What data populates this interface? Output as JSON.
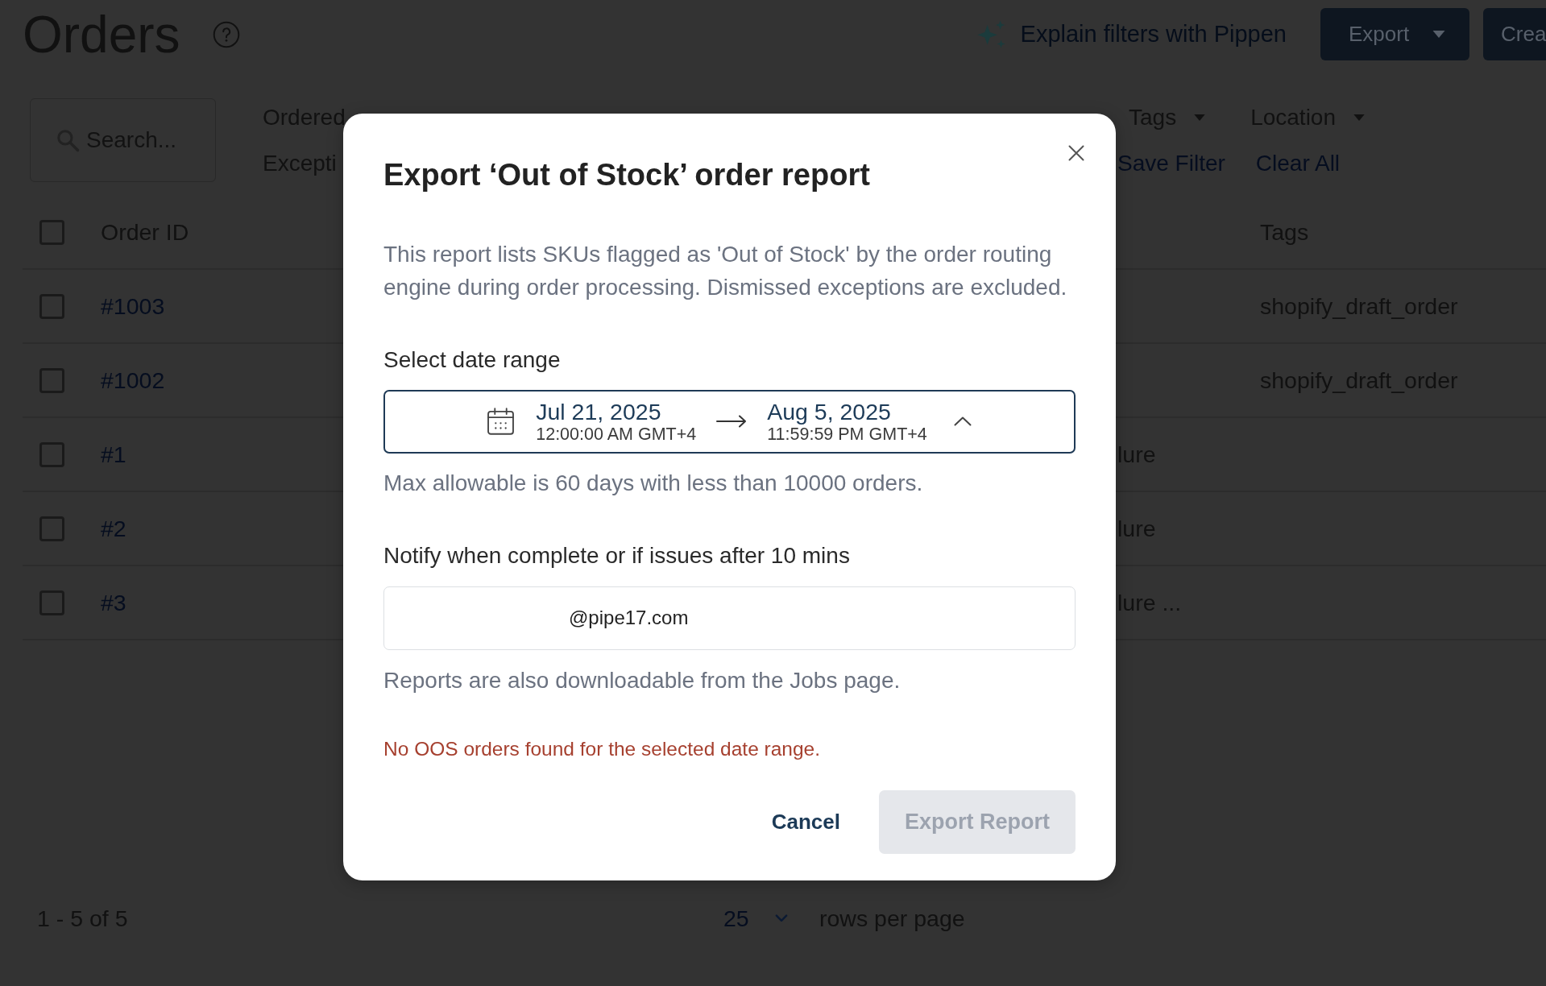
{
  "header": {
    "title": "Orders",
    "assistant_link": "Explain filters with Pippen",
    "buttons": [
      {
        "label": "Export",
        "kind": "dropdown"
      },
      {
        "label": "Crea",
        "kind": "primary"
      }
    ]
  },
  "search": {
    "placeholder": "Search..."
  },
  "filters": {
    "first_row": [
      {
        "label": "Ordered",
        "kind": "plain"
      },
      {
        "label": "Tags",
        "kind": "dropdown"
      },
      {
        "label": "Location",
        "kind": "dropdown"
      }
    ],
    "second_row": [
      {
        "label": "Excepti",
        "kind": "plain"
      },
      {
        "label": "Save Filter",
        "kind": "link"
      },
      {
        "label": "Clear All",
        "kind": "link"
      }
    ]
  },
  "table": {
    "select_all_checked": false,
    "columns": [
      {
        "label": "Order ID"
      },
      {
        "label": "Tags"
      }
    ],
    "rows": [
      {
        "checked": false,
        "order_id": "#1003",
        "tags": "shopify_draft_order"
      },
      {
        "checked": false,
        "order_id": "#1002",
        "tags": "shopify_draft_order"
      },
      {
        "checked": false,
        "order_id": "#1",
        "column_2": "lure"
      },
      {
        "checked": false,
        "order_id": "#2",
        "column_2": "lure"
      },
      {
        "checked": false,
        "order_id": "#3",
        "column_2": "lure ..."
      }
    ]
  },
  "pagination": {
    "range": "1 - 5 of 5",
    "rows_per_page": "25",
    "rows_per_page_label": "rows per page"
  },
  "modal": {
    "title": "Export ‘Out of Stock’ order report",
    "description": "This report lists SKUs flagged as 'Out of Stock' by the order routing engine during order processing. Dismissed exceptions are excluded.",
    "date_range": {
      "label": "Select date range",
      "start_date": "Jul 21, 2025",
      "start_time": "12:00:00 AM GMT+4",
      "end_date": "Aug 5, 2025",
      "end_time": "11:59:59 PM GMT+4",
      "expanded": true,
      "hint": "Max allowable is 60 days with less than 10000 orders."
    },
    "notify": {
      "label": "Notify when complete or if issues after 10 mins",
      "value": "@pipe17.com",
      "hint": "Reports are also downloadable from the Jobs page."
    },
    "error": "No OOS orders found for the selected date range.",
    "buttons": [
      {
        "label": "Cancel",
        "kind": "text",
        "disabled": false
      },
      {
        "label": "Export Report",
        "kind": "filled",
        "disabled": true
      }
    ]
  }
}
